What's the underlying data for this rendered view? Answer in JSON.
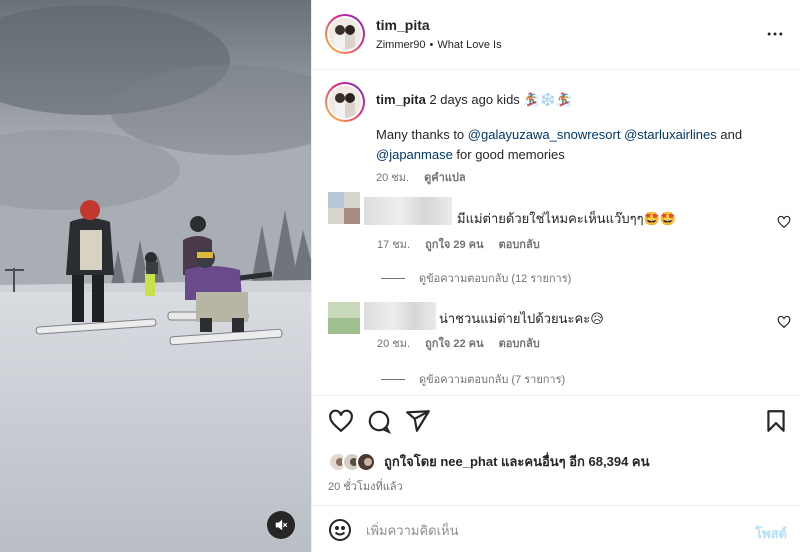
{
  "post": {
    "username": "tim_pita",
    "audio_artist": "Zimmer90",
    "audio_separator": "•",
    "audio_title": "What Love Is",
    "more_icon": "more-horizontal-icon"
  },
  "caption": {
    "username": "tim_pita",
    "text": "2 days ago kids 🏂❄️🏂",
    "body_prefix": "Many thanks to ",
    "mention1": "@galayuzawa_snowresort",
    "mention2": "@starluxairlines",
    "body_and": " and",
    "mention3": "@japanmase",
    "body_suffix": " for good memories",
    "time": "20 ชม.",
    "translate": "ดูคำแปล"
  },
  "comments": [
    {
      "text": "มีแม่ต่ายด้วยใช่ไหมคะเห็นแว๊บๆๆ🤩🤩",
      "time": "17 ชม.",
      "likes": "ถูกใจ 29 คน",
      "reply": "ตอบกลับ",
      "view_replies": "ดูข้อความตอบกลับ (12 รายการ)"
    },
    {
      "text": "น่าชวนแม่ต่ายไปด้วยนะคะ😥",
      "time": "20 ชม.",
      "likes": "ถูกใจ 22 คน",
      "reply": "ตอบกลับ",
      "view_replies": "ดูข้อความตอบกลับ (7 รายการ)"
    }
  ],
  "actions": {
    "like_icon": "heart-icon",
    "comment_icon": "comment-icon",
    "share_icon": "send-icon",
    "save_icon": "bookmark-icon",
    "liked_by": "ถูกใจโดย nee_phat และคนอื่นๆ อีก 68,394 คน",
    "time_ago": "20 ชั่วโมงที่แล้ว"
  },
  "add_comment": {
    "placeholder": "เพิ่มความคิดเห็น",
    "post_label": "โพสต์",
    "emoji_icon": "smiley-icon"
  },
  "media": {
    "mute_icon": "speaker-muted-icon"
  },
  "colors": {
    "accent_link": "#00376b",
    "post_button_disabled": "#b2dffc",
    "muted_text": "#737373"
  }
}
